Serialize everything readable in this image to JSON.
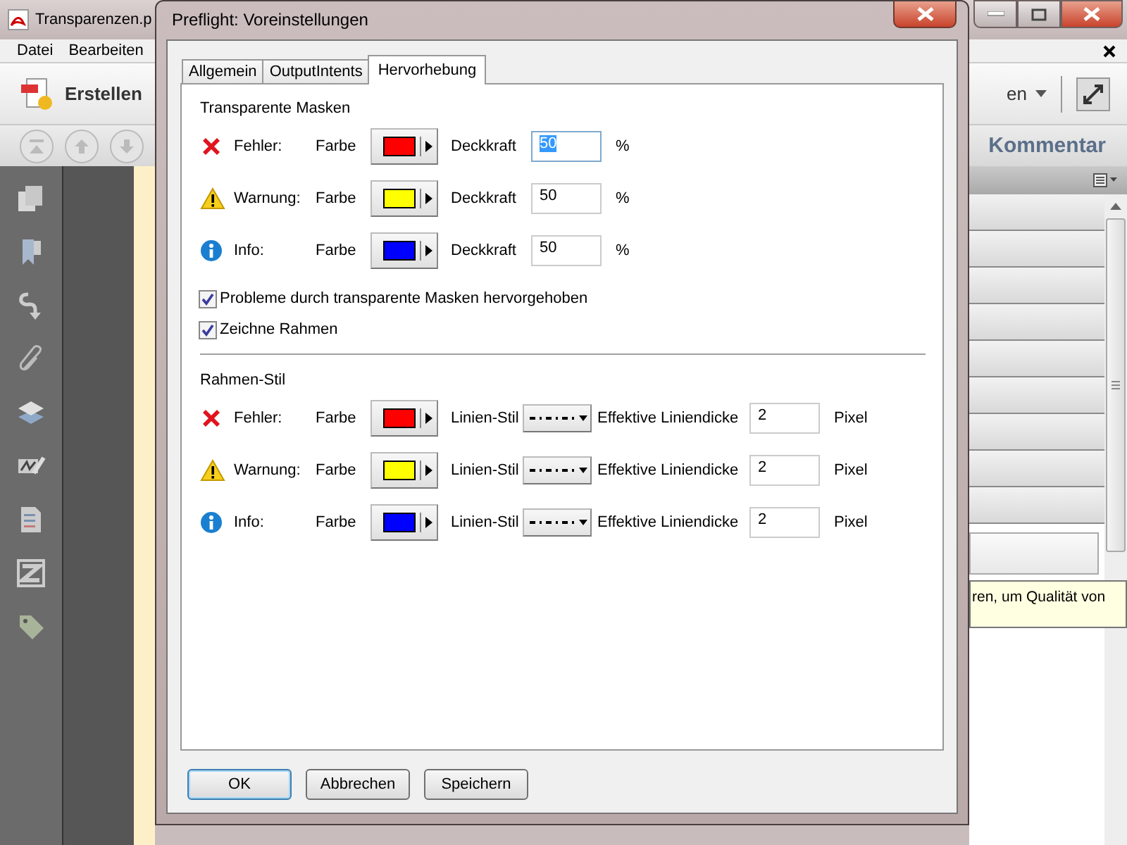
{
  "app": {
    "title": "Transparenzen.p",
    "menu": [
      {
        "label": "Datei"
      },
      {
        "label": "Bearbeiten"
      }
    ],
    "create_button": "Erstellen",
    "right_tool": "en",
    "comment_tab": "Kommentar",
    "tooltip": "ren, um Qualität von"
  },
  "dialog": {
    "title": "Preflight: Voreinstellungen",
    "tabs": [
      {
        "label": "Allgemein",
        "selected": false
      },
      {
        "label": "OutputIntents",
        "selected": false
      },
      {
        "label": "Hervorhebung",
        "selected": true
      }
    ],
    "masks": {
      "title": "Transparente Masken",
      "rows": [
        {
          "kind": "error",
          "label": "Fehler:",
          "color_label": "Farbe",
          "color": "#ff0000",
          "value_label": "Deckkraft",
          "value": "50",
          "value_selected": true,
          "unit": "%"
        },
        {
          "kind": "warning",
          "label": "Warnung:",
          "color_label": "Farbe",
          "color": "#ffff00",
          "value_label": "Deckkraft",
          "value": "50",
          "value_selected": false,
          "unit": "%"
        },
        {
          "kind": "info",
          "label": "Info:",
          "color_label": "Farbe",
          "color": "#0000ff",
          "value_label": "Deckkraft",
          "value": "50",
          "value_selected": false,
          "unit": "%"
        }
      ],
      "checkboxes": [
        {
          "label": "Probleme durch transparente Masken hervorgehoben",
          "checked": true
        },
        {
          "label": "Zeichne Rahmen",
          "checked": true
        }
      ]
    },
    "frame_style": {
      "title": "Rahmen-Stil",
      "rows": [
        {
          "kind": "error",
          "label": "Fehler:",
          "color_label": "Farbe",
          "color": "#ff0000",
          "line_label": "Linien-Stil",
          "thickness_label": "Effektive Liniendicke",
          "value": "2",
          "unit": "Pixel"
        },
        {
          "kind": "warning",
          "label": "Warnung:",
          "color_label": "Farbe",
          "color": "#ffff00",
          "line_label": "Linien-Stil",
          "thickness_label": "Effektive Liniendicke",
          "value": "2",
          "unit": "Pixel"
        },
        {
          "kind": "info",
          "label": "Info:",
          "color_label": "Farbe",
          "color": "#0000ff",
          "line_label": "Linien-Stil",
          "thickness_label": "Effektive Liniendicke",
          "value": "2",
          "unit": "Pixel"
        }
      ]
    },
    "buttons": [
      {
        "label": "OK",
        "default": true
      },
      {
        "label": "Abbrechen",
        "default": false
      },
      {
        "label": "Speichern",
        "default": false
      }
    ]
  }
}
